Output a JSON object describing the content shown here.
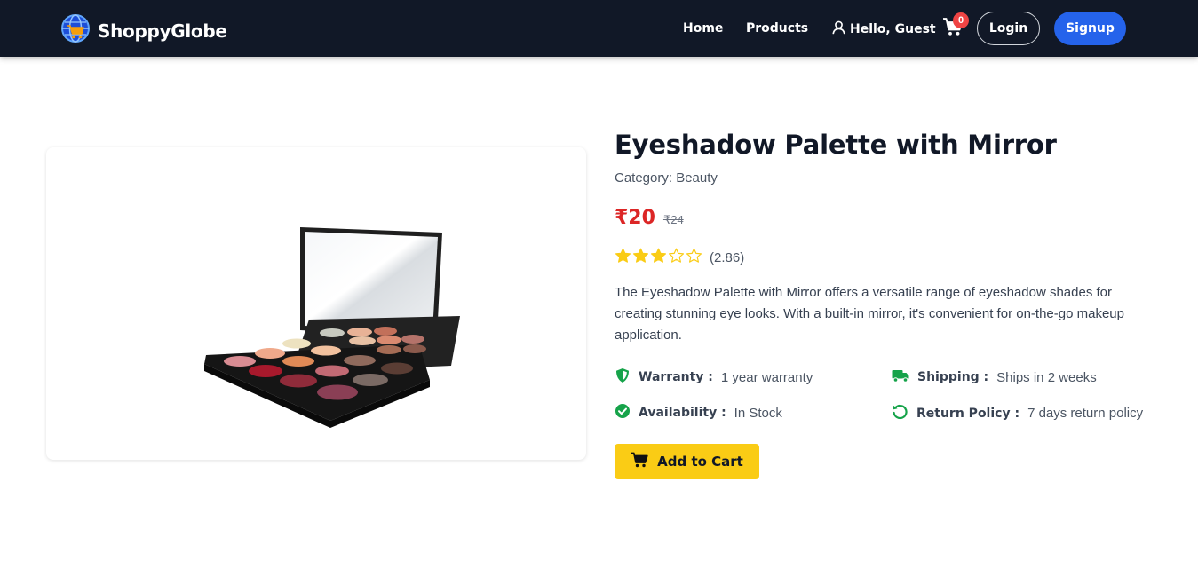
{
  "brand": {
    "name": "ShoppyGlobe",
    "logo_icon": "globe-cart-icon"
  },
  "nav": {
    "home": "Home",
    "products": "Products",
    "greeting": "Hello, Guest",
    "cart_count": "0",
    "login": "Login",
    "signup": "Signup"
  },
  "product": {
    "title": "Eyeshadow Palette with Mirror",
    "category": "Category: Beauty",
    "price": "₹20",
    "original_price": "₹24",
    "rating": 2.86,
    "rating_text": "(2.86)",
    "description": "The Eyeshadow Palette with Mirror offers a versatile range of eyeshadow shades for creating stunning eye looks. With a built-in mirror, it's convenient for on-the-go makeup application.",
    "warranty_label": "Warranty :",
    "warranty_value": "1 year warranty",
    "shipping_label": "Shipping :",
    "shipping_value": "Ships in 2 weeks",
    "availability_label": "Availability :",
    "availability_value": "In Stock",
    "return_label": "Return Policy :",
    "return_value": "7 days return policy",
    "add_to_cart": "Add to Cart"
  },
  "colors": {
    "navbar_bg": "#111827",
    "signup_bg": "#2563eb",
    "price": "#dc2626",
    "star": "#facc15",
    "info_icon": "#16a34a",
    "cart_button": "#facc15"
  }
}
